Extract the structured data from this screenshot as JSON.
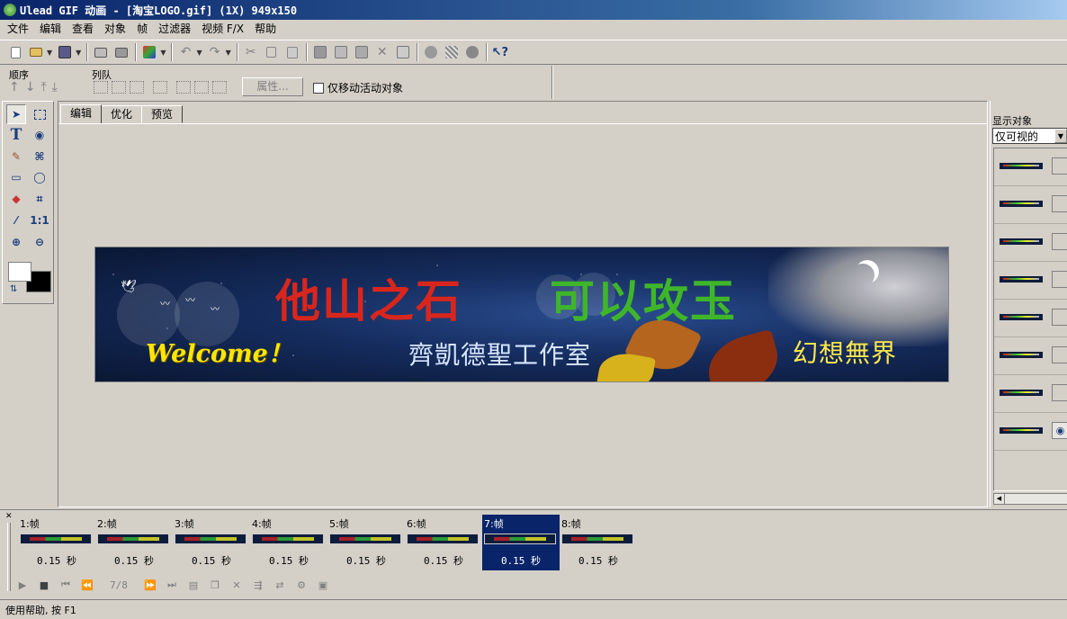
{
  "window": {
    "title": "Ulead GIF 动画 - [淘宝LOGO.gif] (1X) 949x150"
  },
  "menu": [
    "文件",
    "编辑",
    "查看",
    "对象",
    "帧",
    "过滤器",
    "视频 F/X",
    "帮助"
  ],
  "toolbar": {
    "icons": [
      "new-icon",
      "open-icon",
      "save-icon",
      "print-icon",
      "print-preview-icon",
      "wizard-icon",
      "undo-icon",
      "redo-icon",
      "cut-icon",
      "copy-icon",
      "paste-icon",
      "duplicate-icon",
      "layer-icon",
      "image-icon",
      "delete-icon",
      "merge-icon",
      "browser-icon",
      "optimize-icon",
      "export-icon",
      "context-help-icon"
    ]
  },
  "panel": {
    "order_label": "顺序",
    "queue_label": "列队",
    "properties_button": "属性...",
    "move_active_only_label": "仅移动活动对象",
    "move_active_only_checked": false
  },
  "tabs": [
    {
      "label": "编辑",
      "active": true
    },
    {
      "label": "优化",
      "active": false
    },
    {
      "label": "预览",
      "active": false
    }
  ],
  "banner": {
    "line1_red": "他山之石",
    "line1_green": "可以攻玉",
    "welcome": "Welcome！",
    "studio": "齊凱德聖工作室",
    "fantasy": "幻想無界"
  },
  "right_panel": {
    "label": "显示对象",
    "filter_value": "仅可视的",
    "object_count": 8,
    "visible_eye_row": 8
  },
  "frames": [
    {
      "label": "1:帧",
      "delay": "0.15 秒",
      "selected": false
    },
    {
      "label": "2:帧",
      "delay": "0.15 秒",
      "selected": false
    },
    {
      "label": "3:帧",
      "delay": "0.15 秒",
      "selected": false
    },
    {
      "label": "4:帧",
      "delay": "0.15 秒",
      "selected": false
    },
    {
      "label": "5:帧",
      "delay": "0.15 秒",
      "selected": false
    },
    {
      "label": "6:帧",
      "delay": "0.15 秒",
      "selected": false
    },
    {
      "label": "7:帧",
      "delay": "0.15 秒",
      "selected": true
    },
    {
      "label": "8:帧",
      "delay": "0.15 秒",
      "selected": false
    }
  ],
  "playback": {
    "counter": "7/8"
  },
  "status": {
    "text": "使用帮助, 按 F1"
  }
}
